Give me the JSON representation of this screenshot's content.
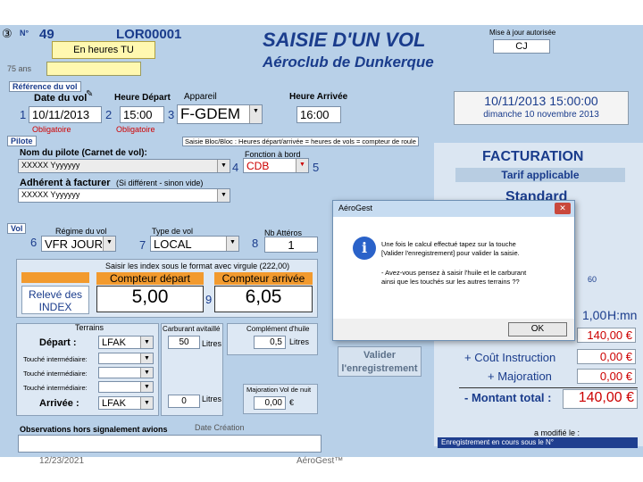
{
  "header": {
    "record_symbol": "③",
    "no_label": "N°",
    "flight_no": "49",
    "record_code": "LOR00001",
    "time_mode": "En heures TU",
    "title": "SAISIE D'UN VOL",
    "subtitle": "Aéroclub de Dunkerque",
    "small_label": "75 ans",
    "updated_by_label": "Mise à jour autorisée",
    "updated_by_value": "CJ"
  },
  "flight_ref": {
    "section_label": "Référence du vol",
    "date_label": "Date du vol",
    "date_value": "10/11/2013",
    "date_num": "1",
    "date_note": "Obligatoire",
    "dep_label": "Heure Départ",
    "dep_value": "15:00",
    "dep_num": "2",
    "aircraft_label": "Appareil",
    "aircraft_value": "F-GDEM",
    "aircraft_num": "3",
    "arr_label": "Heure Arrivée",
    "arr_value": "16:00",
    "summary_datetime": "10/11/2013 15:00:00",
    "summary_day": "dimanche 10 novembre 2013"
  },
  "pilot": {
    "section_label": "Pilote",
    "note": "Saisie Bloc/Bloc : Heures départ/arrivée = heures de vols = compteur de roule",
    "name_label": "Nom du pilote (Carnet de vol):",
    "name_value": "XXXXX Yyyyyyy",
    "name_num": "4",
    "fonction_label": "Fonction à bord",
    "fonction_value": "CDB",
    "fonction_num": "5",
    "adherent_label": "Adhérent à facturer",
    "adherent_note": "(Si différent - sinon vide)",
    "adherent_value": "XXXXX Yyyyyyy"
  },
  "vol": {
    "section_label": "Vol",
    "regime_label": "Régime du vol",
    "regime_value": "VFR JOUR",
    "regime_num": "6",
    "type_label": "Type de vol",
    "type_value": "LOCAL",
    "type_num": "7",
    "atterro_label": "Nb Attéros",
    "atterro_value": "1",
    "atterro_num": "8",
    "index_instruction": "Saisir les index sous le format avec virgule (222,00)",
    "releve_label": "Relevé des INDEX",
    "depart_counter_label": "Compteur départ",
    "depart_counter_value": "5,00",
    "arrive_counter_label": "Compteur arrivée",
    "arrive_counter_value": "6,05",
    "counter_num": "9"
  },
  "terrains": {
    "section_label": "Terrains",
    "depart_label": "Départ :",
    "depart_value": "LFAK",
    "inter1_label": "Touché intermédiaire:",
    "inter2_label": "Touché intermédiaire:",
    "inter3_label": "Touché intermédiaire:",
    "arrivee_label": "Arrivée :",
    "arrivee_value": "LFAK",
    "carburant_label": "Carburant avitaillé",
    "carburant_value": "50",
    "carburant_unit": "Litres",
    "carburant2_value": "0",
    "carburant2_unit": "Litres",
    "huile_label": "Complément d'huile",
    "huile_value": "0,5",
    "huile_unit": "Litres",
    "majoration_label": "Majoration Vol de nuit",
    "majoration_value": "0,00",
    "majoration_unit": "€",
    "valider_label": "Valider l'enregistrement",
    "observations_label": "Observations hors signalement avions",
    "date_creation_label": "Date Création"
  },
  "facturation": {
    "title": "FACTURATION",
    "tarif_label": "Tarif applicable",
    "tarif_value": "Standard",
    "tarif_number": "60",
    "duree_value": "1,00",
    "duree_unit": "H:mn",
    "base_value": "140,00 €",
    "instruction_label": "+ Coût Instruction",
    "instruction_value": "0,00 €",
    "majoration_label": "+ Majoration",
    "majoration_value": "0,00 €",
    "total_label": "- Montant total :",
    "total_value": "140,00 €",
    "modifie_label": "a modifié le :",
    "status_text": "Enregistrement en cours sous le N°"
  },
  "dialog": {
    "title": "AéroGest",
    "close": "✕",
    "line1": "Une fois le calcul effectué tapez sur la touche",
    "line2": "[Valider l'enregistrement] pour valider la saisie.",
    "line3": "- Avez-vous pensez à saisir l'huile et le carburant",
    "line4": "ainsi que les touchés sur les autres terrains ??",
    "ok_label": "OK"
  },
  "footer": {
    "date": "12/23/2021",
    "app": "AéroGest™"
  }
}
